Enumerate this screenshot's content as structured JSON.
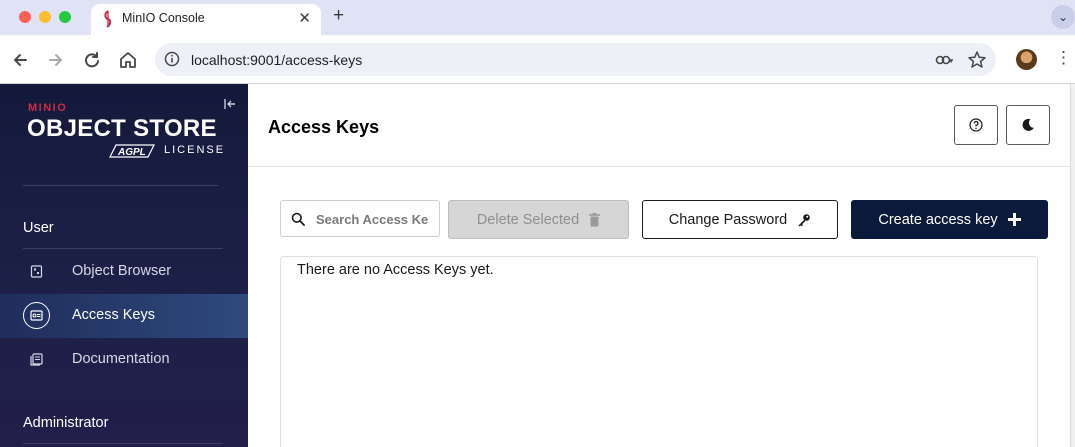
{
  "browser": {
    "tab_title": "MinIO Console",
    "url": "localhost:9001/access-keys",
    "new_tab_symbol": "+",
    "tab_close_symbol": "✕",
    "icons": [
      "back-icon",
      "forward-icon",
      "reload-icon",
      "home-icon",
      "site-info-icon",
      "password-key-icon",
      "bookmark-star-icon",
      "profile-avatar",
      "more-menu-icon",
      "tab-search-icon"
    ]
  },
  "sidebar": {
    "logo": {
      "brand": "MINIO",
      "product": "OBJECT STORE",
      "badge": "AGPL",
      "license": "LICENSE"
    },
    "sections": [
      {
        "label": "User"
      },
      {
        "label": "Administrator"
      }
    ],
    "items": [
      {
        "label": "Object Browser",
        "icon": "object-browser-icon",
        "active": false
      },
      {
        "label": "Access Keys",
        "icon": "access-keys-icon",
        "active": true
      },
      {
        "label": "Documentation",
        "icon": "documentation-icon",
        "active": false
      }
    ]
  },
  "header": {
    "title": "Access Keys",
    "help_icon": "help-icon",
    "theme_icon": "dark-mode-icon"
  },
  "actions": {
    "search_placeholder": "Search Access Keys",
    "delete_label": "Delete Selected",
    "change_password_label": "Change Password",
    "create_label": "Create access key"
  },
  "list": {
    "empty_message": "There are no Access Keys yet."
  },
  "colors": {
    "sidebar_bg": "#1d2048",
    "sidebar_active": "#2f4a7c",
    "primary_button": "#0b1a3a",
    "disabled_button": "#d6d6d6",
    "brand_red": "#c72c48",
    "browser_tabbar": "#dfe3f5"
  }
}
